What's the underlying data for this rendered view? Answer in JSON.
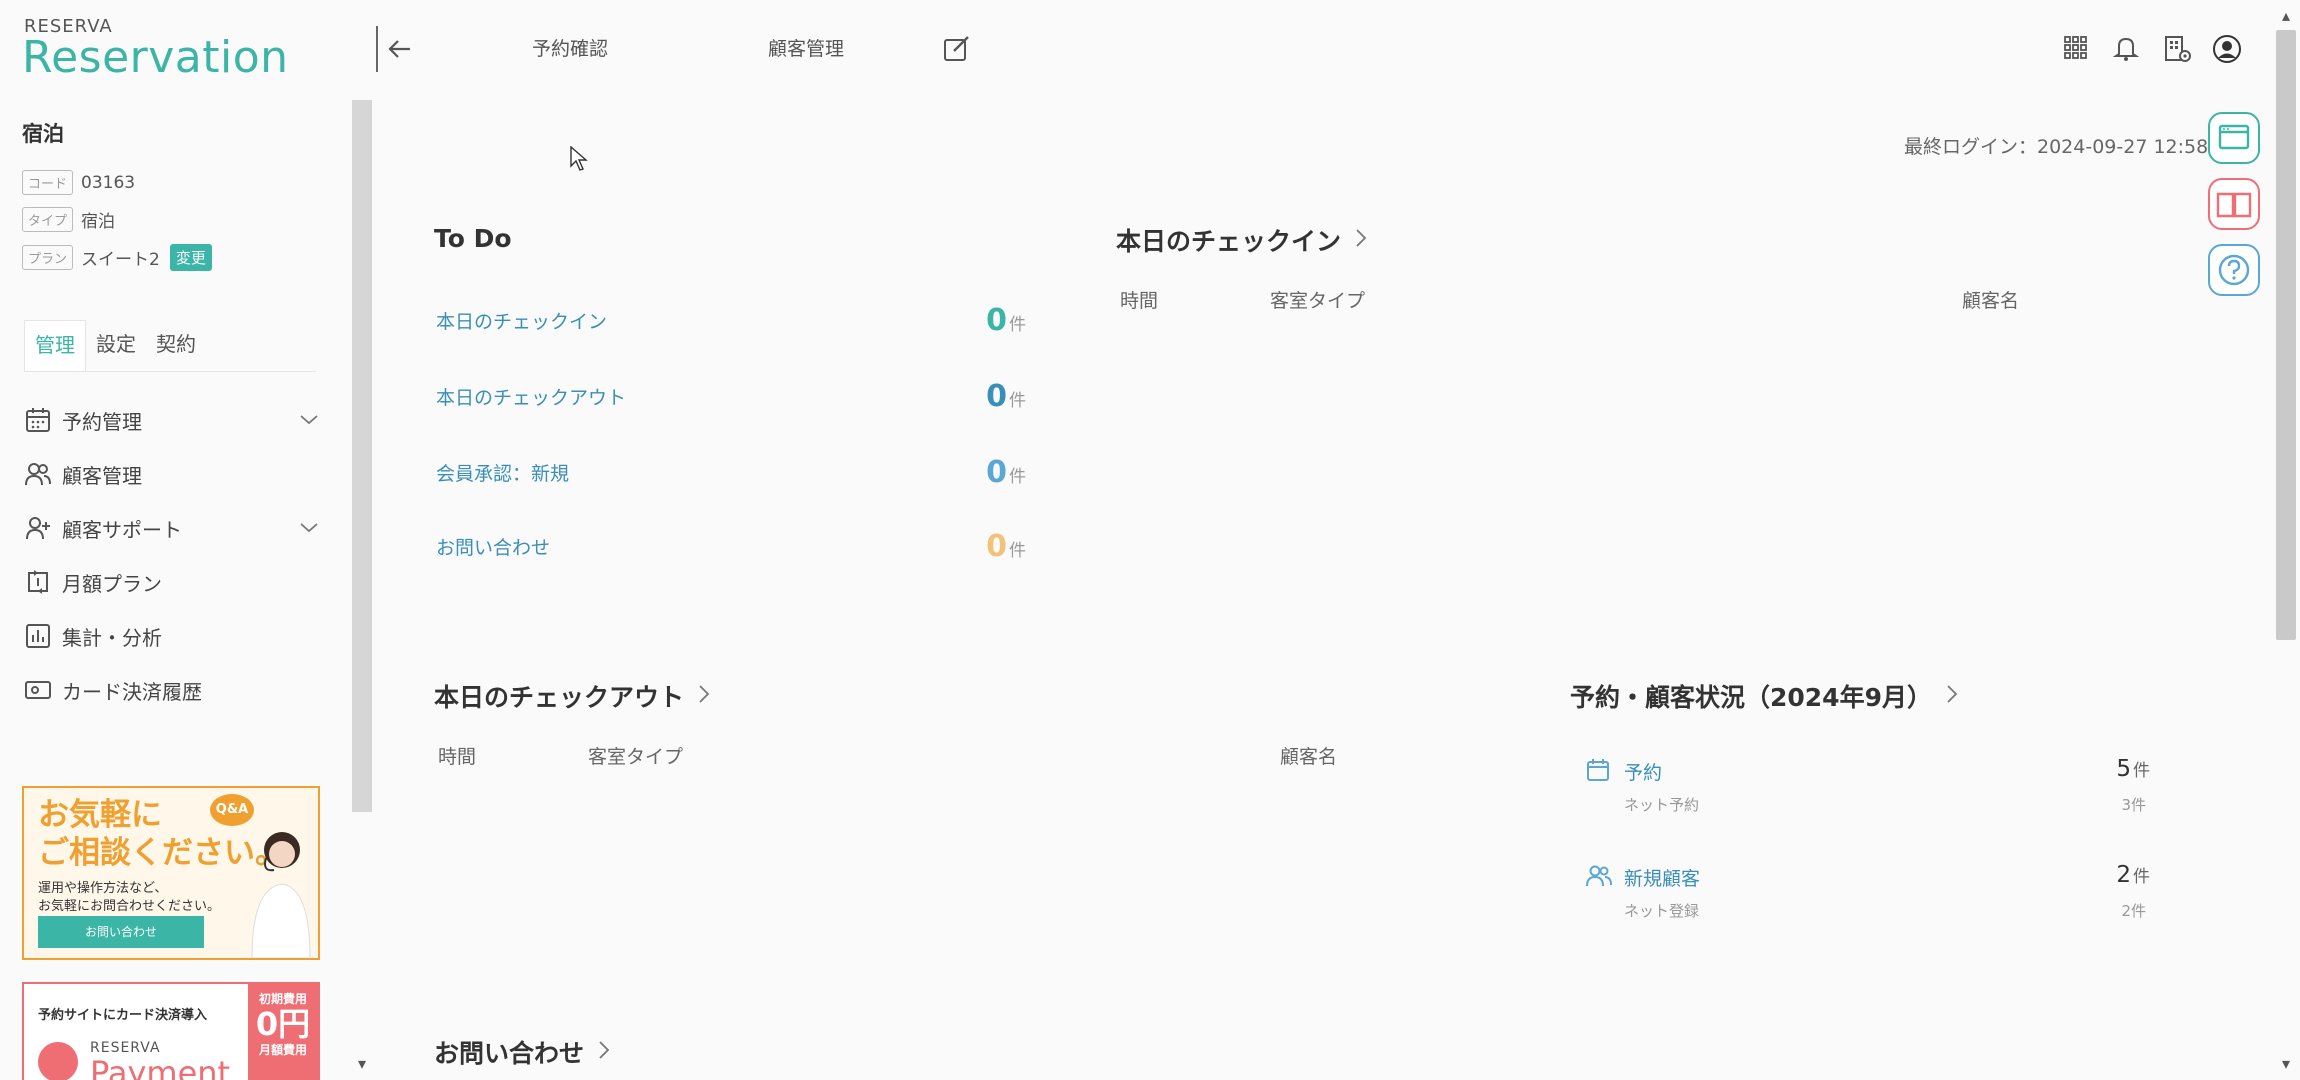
{
  "brand": {
    "small": "RESERVA",
    "name": "Reservation"
  },
  "store": {
    "name": "宿泊",
    "code_tag": "コード",
    "code": "03163",
    "type_tag": "タイプ",
    "type": "宿泊",
    "plan_tag": "プラン",
    "plan": "スイート2",
    "change_label": "変更"
  },
  "sidebar": {
    "tabs": [
      "管理",
      "設定",
      "契約"
    ],
    "items": [
      {
        "label": "予約管理",
        "icon": "calendar-icon",
        "expandable": true
      },
      {
        "label": "顧客管理",
        "icon": "users-icon",
        "expandable": false
      },
      {
        "label": "顧客サポート",
        "icon": "user-plus-icon",
        "expandable": true
      },
      {
        "label": "月額プラン",
        "icon": "repeat-icon",
        "expandable": false
      },
      {
        "label": "集計・分析",
        "icon": "chart-icon",
        "expandable": false
      },
      {
        "label": "カード決済履歴",
        "icon": "card-icon",
        "expandable": false
      }
    ],
    "banner1": {
      "line1": "お気軽に",
      "line2": "ご相談ください。",
      "qa": "Q&A",
      "desc1": "運用や操作方法など、",
      "desc2": "お気軽にお問合わせください。",
      "button": "お問い合わせ"
    },
    "banner2": {
      "title": "予約サイトにカード決済導入",
      "side1": "初期費用",
      "side2": "0円",
      "side3": "月額費用",
      "brand_small": "RESERVA",
      "brand_big": "Payment"
    }
  },
  "header": {
    "links": [
      "予約確認",
      "顧客管理"
    ],
    "edit_icon": "edit-icon",
    "right_icons": [
      "grid-icon",
      "bell-icon",
      "building-settings-icon",
      "account-icon"
    ]
  },
  "login_info": "最終ログイン：2024-09-27 12:58",
  "todo": {
    "title": "To Do",
    "unit": "件",
    "items": [
      {
        "label": "本日のチェックイン",
        "count": "0",
        "color": "#3ab5a6"
      },
      {
        "label": "本日のチェックアウト",
        "count": "0",
        "color": "#3a8fb7"
      },
      {
        "label": "会員承認：新規",
        "count": "0",
        "color": "#5aa7d6"
      },
      {
        "label": "お問い合わせ",
        "count": "0",
        "color": "#f3c27a"
      }
    ]
  },
  "checkin": {
    "title": "本日のチェックイン",
    "columns": [
      "時間",
      "客室タイプ",
      "顧客名"
    ]
  },
  "checkout": {
    "title": "本日のチェックアウト",
    "columns": [
      "時間",
      "客室タイプ",
      "顧客名"
    ]
  },
  "status": {
    "title": "予約・顧客状況（2024年9月）",
    "rows": [
      {
        "label": "予約",
        "sub": "ネット予約",
        "value": "5",
        "sub_value": "3件",
        "icon": "calendar-icon"
      },
      {
        "label": "新規顧客",
        "sub": "ネット登録",
        "value": "2",
        "sub_value": "2件",
        "icon": "users-icon"
      }
    ],
    "unit": "件"
  },
  "inquiry": {
    "title": "お問い合わせ"
  },
  "colors": {
    "accent": "#3ab5a6",
    "link": "#3a8fb7",
    "pink": "#ee6e73",
    "orange": "#f0a030"
  }
}
